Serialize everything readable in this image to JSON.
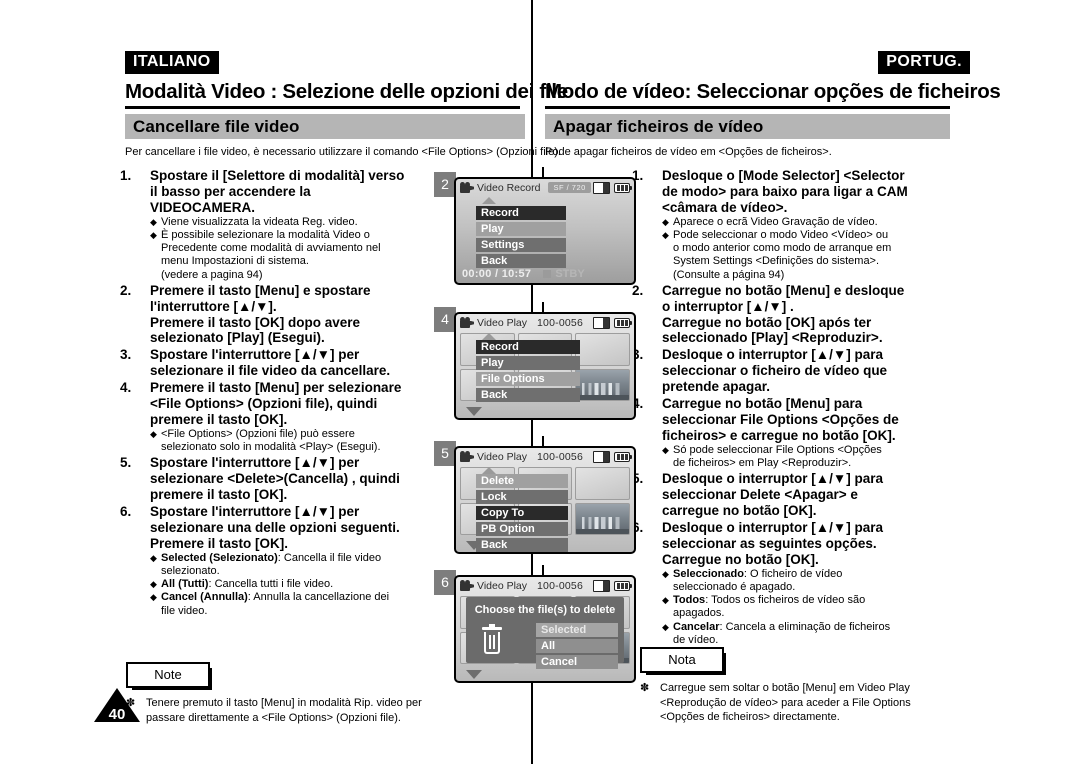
{
  "page": {
    "number": "40"
  },
  "left": {
    "language_tag": "ITALIANO",
    "chapter_title": "Modalità Video : Selezione delle opzioni dei file",
    "section_title": "Cancellare file video",
    "intro": "Per cancellare i file video, è necessario utilizzare il comando <File Options> (Opzioni file).",
    "steps": [
      {
        "num": "1.",
        "lines": [
          "Spostare il [Selettore di modalità] verso",
          "il basso per accendere la",
          "VIDEOCAMERA."
        ],
        "bullets": [
          {
            "lines": [
              "Viene visualizzata la videata Reg. video."
            ]
          },
          {
            "lines": [
              "È possibile selezionare la modalità Video o",
              "Precedente come modalità di avviamento nel",
              "menu Impostazioni di sistema.",
              "(vedere a pagina 94)"
            ]
          }
        ]
      },
      {
        "num": "2.",
        "lines": [
          "Premere il tasto [Menu] e spostare",
          "l'interruttore [▲/▼].",
          "Premere il tasto [OK] dopo avere",
          "selezionato [Play] (Esegui)."
        ],
        "bullets": []
      },
      {
        "num": "3.",
        "lines": [
          "Spostare l'interruttore [▲/▼] per",
          "selezionare il file video da cancellare."
        ],
        "bullets": []
      },
      {
        "num": "4.",
        "lines": [
          "Premere il tasto [Menu] per selezionare",
          "<File Options> (Opzioni file), quindi",
          "premere il tasto [OK]."
        ],
        "bullets": [
          {
            "lines": [
              "<File Options> (Opzioni file) può essere",
              "selezionato solo in modalità <Play> (Esegui)."
            ]
          }
        ]
      },
      {
        "num": "5.",
        "lines": [
          "Spostare l'interruttore [▲/▼]  per",
          "selezionare <Delete>(Cancella) , quindi",
          "premere il tasto [OK]."
        ],
        "bullets": []
      },
      {
        "num": "6.",
        "lines": [
          "Spostare l'interruttore [▲/▼] per",
          "selezionare una delle opzioni seguenti.",
          "Premere il tasto [OK]."
        ],
        "bullets": [
          {
            "bold": "Selected (Selezionato)",
            "lines": [
              ": Cancella il file video",
              "selezionato."
            ]
          },
          {
            "bold": "All (Tutti)",
            "lines": [
              ": Cancella tutti i file video."
            ]
          },
          {
            "bold": "Cancel (Annulla)",
            "lines": [
              ": Annulla la cancellazione dei",
              "file video."
            ]
          }
        ]
      }
    ],
    "note_label": "Note",
    "note_mark": "✽",
    "note_lines": [
      "Tenere premuto il tasto [Menu] in modalità Rip. video per",
      "passare direttamente a <File Options> (Opzioni file)."
    ]
  },
  "right": {
    "language_tag": "PORTUG.",
    "chapter_title": "Modo de vídeo: Seleccionar opções de ficheiros",
    "section_title": "Apagar ficheiros de vídeo",
    "intro": "Pode apagar ficheiros de vídeo em <Opções de ficheiros>.",
    "steps": [
      {
        "num": "1.",
        "lines": [
          "Desloque o [Mode Selector] <Selector",
          "de modo> para baixo para ligar a CAM",
          "<câmara de vídeo>."
        ],
        "bullets": [
          {
            "lines": [
              "Aparece o ecrã Video Gravação de vídeo."
            ]
          },
          {
            "lines": [
              "Pode seleccionar o modo Video <Vídeo> ou",
              "o modo anterior como modo de arranque em",
              "System Settings <Definições do sistema>.",
              "(Consulte a página 94)"
            ]
          }
        ]
      },
      {
        "num": "2.",
        "lines": [
          "Carregue no botão [Menu] e desloque",
          "o interruptor  [▲/▼] .",
          "Carregue no botão [OK] após ter",
          "seleccionado [Play] <Reproduzir>."
        ],
        "bullets": []
      },
      {
        "num": "3.",
        "lines": [
          "Desloque o interruptor [▲/▼] para",
          "seleccionar o ficheiro de vídeo que",
          "pretende apagar."
        ],
        "bullets": []
      },
      {
        "num": "4.",
        "lines": [
          "Carregue no botão [Menu] para",
          "seleccionar File Options <Opções de",
          "ficheiros> e carregue no botão [OK]."
        ],
        "bullets": [
          {
            "lines": [
              "Só pode seleccionar File Options <Opções",
              "de ficheiros> em Play <Reproduzir>."
            ]
          }
        ]
      },
      {
        "num": "5.",
        "lines": [
          "Desloque o interruptor [▲/▼] para",
          "seleccionar Delete <Apagar> e",
          "carregue no botão [OK]."
        ],
        "bullets": []
      },
      {
        "num": "6.",
        "lines": [
          "Desloque o interruptor [▲/▼] para",
          "seleccionar as seguintes opções.",
          "Carregue no botão [OK]."
        ],
        "bullets": [
          {
            "bold": "Seleccionado",
            "lines": [
              ": O ficheiro de vídeo",
              "seleccionado é apagado."
            ]
          },
          {
            "bold": "Todos",
            "lines": [
              ": Todos os ficheiros de vídeo são",
              "apagados."
            ]
          },
          {
            "bold": "Cancelar",
            "lines": [
              ": Cancela a eliminação de ficheiros",
              "de vídeo."
            ]
          }
        ]
      }
    ],
    "note_label": "Nota",
    "note_mark": "✽",
    "note_lines": [
      "Carregue sem soltar o botão [Menu] em Video Play",
      "<Reprodução de vídeo> para aceder a File Options",
      "<Opções de ficheiros> directamente."
    ]
  },
  "screens": [
    {
      "badge": "2",
      "title": "Video Record",
      "quality": "SF  /  720",
      "menu": [
        {
          "label": "Record",
          "state": "selected"
        },
        {
          "label": "Play",
          "state": "light"
        },
        {
          "label": "Settings",
          "state": "normal"
        },
        {
          "label": "Back",
          "state": "normal"
        }
      ],
      "rec_time": "00:00 / 10:57",
      "rec_status": "STBY"
    },
    {
      "badge": "4",
      "title": "Video Play",
      "file_no": "100-0056",
      "menu": [
        {
          "label": "Record",
          "state": "selected"
        },
        {
          "label": "Play",
          "state": "normal"
        },
        {
          "label": "File Options",
          "state": "light"
        },
        {
          "label": "Back",
          "state": "normal"
        }
      ]
    },
    {
      "badge": "5",
      "title": "Video Play",
      "file_no": "100-0056",
      "menu": [
        {
          "label": "Delete",
          "state": "light"
        },
        {
          "label": "Lock",
          "state": "normal"
        },
        {
          "label": "Copy To",
          "state": "selected"
        },
        {
          "label": "PB Option",
          "state": "normal"
        },
        {
          "label": "Back",
          "state": "normal"
        }
      ]
    },
    {
      "badge": "6",
      "title": "Video Play",
      "file_no": "100-0056",
      "dialog": {
        "title": "Choose the file(s) to delete",
        "icon": "trash-icon",
        "options": [
          {
            "label": "Selected",
            "state": "highlight"
          },
          {
            "label": "All",
            "state": "normal"
          },
          {
            "label": "Cancel",
            "state": "normal"
          }
        ]
      }
    }
  ]
}
